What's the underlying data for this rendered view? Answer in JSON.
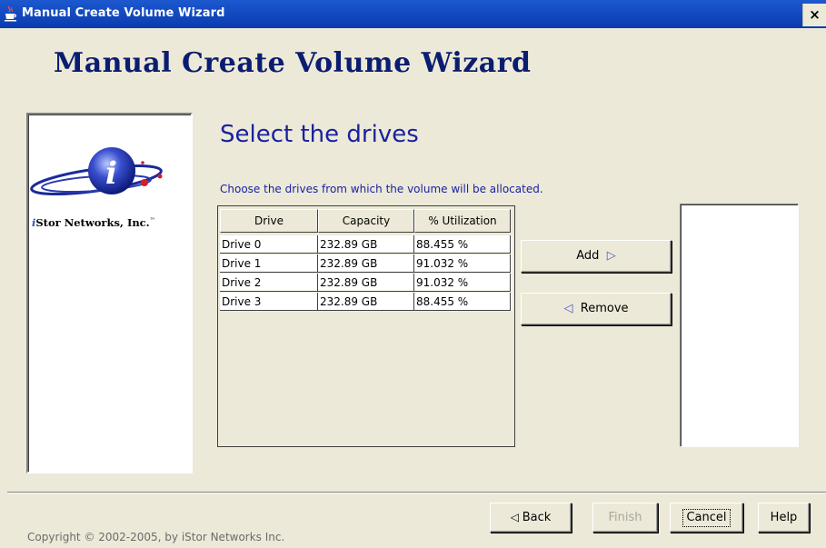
{
  "window": {
    "title": "Manual Create Volume Wizard",
    "close_label": "×",
    "titlebar_color": "#0a3bb0"
  },
  "wizard": {
    "heading": "Manual Create Volume Wizard",
    "step_title": "Select the drives",
    "description": "Choose the drives from which the volume will be allocated."
  },
  "logo": {
    "icon": "istor-globe-logo",
    "company_prefix": "i",
    "company_rest": "Stor Networks, Inc.",
    "trademark": "™"
  },
  "drive_table": {
    "headers": [
      "Drive",
      "Capacity",
      "% Utilization"
    ],
    "rows": [
      [
        "Drive 0",
        "232.89 GB",
        "88.455 %"
      ],
      [
        "Drive 1",
        "232.89 GB",
        "91.032 %"
      ],
      [
        "Drive 2",
        "232.89 GB",
        "91.032 %"
      ],
      [
        "Drive 3",
        "232.89 GB",
        "88.455 %"
      ]
    ]
  },
  "transfer": {
    "add_label": "Add",
    "add_icon": "arrow-right-icon",
    "remove_label": "Remove",
    "remove_icon": "arrow-left-icon"
  },
  "selected_drives": [],
  "footer": {
    "back_label": "Back",
    "finish_label": "Finish",
    "cancel_label": "Cancel",
    "help_label": "Help",
    "copyright": "Copyright © 2002-2005, by iStor Networks Inc."
  },
  "colors": {
    "background": "#ece9d8",
    "heading": "#0b1d70",
    "step_text": "#1a22a0",
    "arrow": "#4a55c8"
  }
}
